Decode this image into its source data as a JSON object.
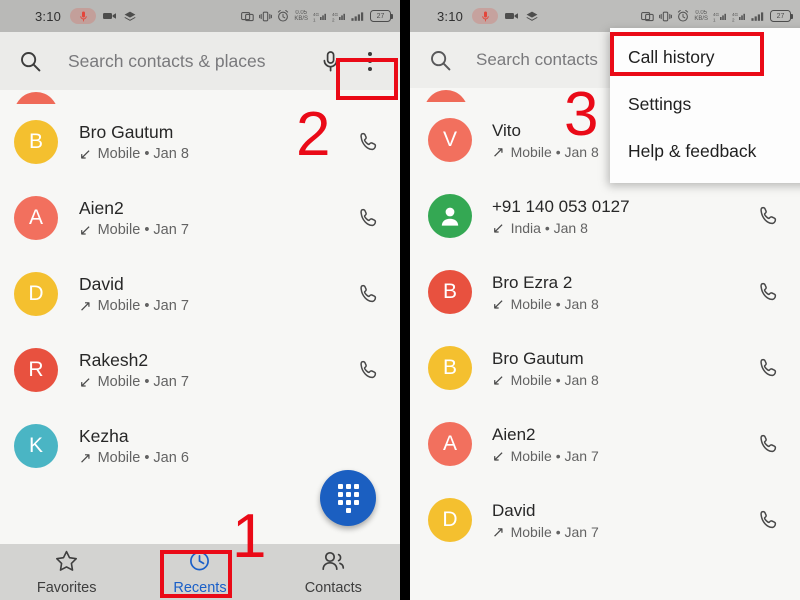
{
  "statusbar": {
    "time": "3:10",
    "battery_text": "27",
    "icons": [
      "mic-icon",
      "video-camera-icon",
      "layers-icon",
      "screenshot-icon",
      "vibrate-icon",
      "alarm-icon",
      "data-rate-icon",
      "sim1-signal-icon",
      "sim2-signal-icon",
      "signal-bars-icon",
      "battery-icon"
    ],
    "data_rate_top": "0.05",
    "data_rate_bottom": "KB/S"
  },
  "left_panel": {
    "search": {
      "placeholder": "Search contacts & places",
      "search_icon": "search-icon",
      "mic_icon": "microphone-icon",
      "overflow_icon": "more-vert-icon"
    },
    "recents": [
      {
        "name": "Bro Gautum",
        "detail": "Mobile • Jan 8",
        "direction": "↙",
        "dir_name": "incoming-call-icon",
        "initial": "B",
        "color": "#f4c02f"
      },
      {
        "name": "Aien2",
        "detail": "Mobile • Jan 7",
        "direction": "↙",
        "dir_name": "incoming-call-icon",
        "initial": "A",
        "color": "#f2705e"
      },
      {
        "name": "David",
        "detail": "Mobile • Jan 7",
        "direction": "↗",
        "dir_name": "outgoing-call-icon",
        "initial": "D",
        "color": "#f4c02f"
      },
      {
        "name": "Rakesh2",
        "detail": "Mobile • Jan 7",
        "direction": "↙",
        "dir_name": "incoming-call-icon",
        "initial": "R",
        "color": "#e8513f"
      },
      {
        "name": "Kezha",
        "detail": "Mobile • Jan 6",
        "direction": "↗",
        "dir_name": "outgoing-call-icon",
        "initial": "K",
        "color": "#4ab5c4"
      }
    ],
    "partial_top_avatar_color": "#ef6a58",
    "fab": {
      "icon": "dialpad-icon",
      "color": "#1b5fc1"
    },
    "bottom_nav": [
      {
        "label": "Favorites",
        "icon": "star-icon",
        "active": false
      },
      {
        "label": "Recents",
        "icon": "clock-icon",
        "active": true
      },
      {
        "label": "Contacts",
        "icon": "people-icon",
        "active": false
      }
    ]
  },
  "right_panel": {
    "search": {
      "placeholder": "Search contacts",
      "search_icon": "search-icon"
    },
    "menu": {
      "items": [
        "Call history",
        "Settings",
        "Help & feedback"
      ]
    },
    "recents": [
      {
        "name": "Vito",
        "detail": "Mobile • Jan 8",
        "direction": "↗",
        "dir_name": "outgoing-call-icon",
        "initial": "V",
        "color": "#f2705e",
        "avatar_type": "letter"
      },
      {
        "name": "+91 140 053 0127",
        "detail": "India • Jan 8",
        "direction": "↙",
        "dir_name": "incoming-call-icon",
        "initial": "",
        "color": "#34a853",
        "avatar_type": "person"
      },
      {
        "name": "Bro Ezra 2",
        "detail": "Mobile • Jan 8",
        "direction": "↙",
        "dir_name": "incoming-call-icon",
        "initial": "B",
        "color": "#e8513f",
        "avatar_type": "letter"
      },
      {
        "name": "Bro Gautum",
        "detail": "Mobile • Jan 8",
        "direction": "↙",
        "dir_name": "incoming-call-icon",
        "initial": "B",
        "color": "#f4c02f",
        "avatar_type": "letter"
      },
      {
        "name": "Aien2",
        "detail": "Mobile • Jan 7",
        "direction": "↙",
        "dir_name": "incoming-call-icon",
        "initial": "A",
        "color": "#f2705e",
        "avatar_type": "letter"
      },
      {
        "name": "David",
        "detail": "Mobile • Jan 7",
        "direction": "↗",
        "dir_name": "outgoing-call-icon",
        "initial": "D",
        "color": "#f4c02f",
        "avatar_type": "letter"
      }
    ],
    "partial_top_avatar_color": "#ef6a58"
  },
  "annotations": {
    "color": "#ea0a17",
    "step1": "1",
    "step2": "2",
    "step3": "3"
  }
}
